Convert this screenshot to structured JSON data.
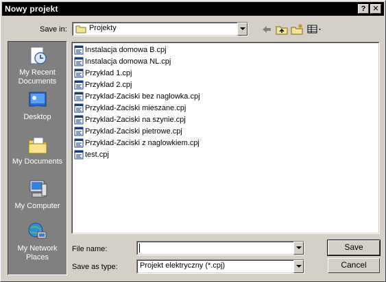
{
  "window": {
    "title": "Nowy projekt",
    "help_label": "?",
    "close_label": "✕"
  },
  "toolbar": {
    "save_in_label": "Save in:",
    "save_in_value": "Projekty",
    "icons": [
      "back-arrow-icon",
      "up-folder-icon",
      "new-folder-icon",
      "view-menu-icon"
    ]
  },
  "places": [
    {
      "label_line1": "My Recent",
      "label_line2": "Documents",
      "icon": "recent-documents-icon"
    },
    {
      "label_line1": "Desktop",
      "label_line2": "",
      "icon": "desktop-icon"
    },
    {
      "label_line1": "My Documents",
      "label_line2": "",
      "icon": "my-documents-icon"
    },
    {
      "label_line1": "My Computer",
      "label_line2": "",
      "icon": "my-computer-icon"
    },
    {
      "label_line1": "My Network",
      "label_line2": "Places",
      "icon": "network-places-icon"
    }
  ],
  "files": [
    "Instalacja domowa B.cpj",
    "Instalacja domowa NL.cpj",
    "Przyklad 1.cpj",
    "Przyklad 2.cpj",
    "Przyklad-Zaciski bez naglowka.cpj",
    "Przyklad-Zaciski mieszane.cpj",
    "Przyklad-Zaciski na szynie.cpj",
    "Przyklad-Zaciski pietrowe.cpj",
    "Przyklad-Zaciski z naglowkiem.cpj",
    "test.cpj"
  ],
  "form": {
    "file_name_label": "File name:",
    "file_name_value": "",
    "save_as_type_label": "Save as type:",
    "save_as_type_value": "Projekt elektryczny (*.cpj)"
  },
  "buttons": {
    "save": "Save",
    "cancel": "Cancel"
  }
}
